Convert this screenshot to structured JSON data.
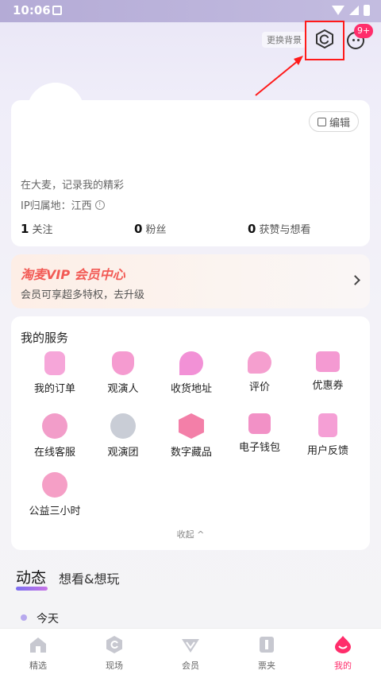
{
  "status_bar": {
    "time": "10:06"
  },
  "header": {
    "change_bg_label": "更换背景",
    "message_badge": "9+"
  },
  "profile": {
    "edit_label": "编辑",
    "bio": "在大麦，记录我的精彩",
    "ip_location": "IP归属地：江西",
    "stats": [
      {
        "value": "1",
        "label": "关注"
      },
      {
        "value": "0",
        "label": "粉丝"
      },
      {
        "value": "0",
        "label": "获赞与想看"
      }
    ]
  },
  "vip": {
    "title": "淘麦VIP 会员中心",
    "subtitle": "会员可享超多特权，去升级"
  },
  "services": {
    "title": "我的服务",
    "items": [
      {
        "label": "我的订单",
        "icon": "order-icon"
      },
      {
        "label": "观演人",
        "icon": "viewer-icon"
      },
      {
        "label": "收货地址",
        "icon": "address-icon"
      },
      {
        "label": "评价",
        "icon": "review-icon"
      },
      {
        "label": "优惠券",
        "icon": "coupon-icon"
      },
      {
        "label": "在线客服",
        "icon": "customer-service-icon"
      },
      {
        "label": "观演团",
        "icon": "group-icon"
      },
      {
        "label": "数字藏品",
        "icon": "digital-collection-icon"
      },
      {
        "label": "电子钱包",
        "icon": "wallet-icon"
      },
      {
        "label": "用户反馈",
        "icon": "feedback-icon"
      },
      {
        "label": "公益三小时",
        "icon": "charity-icon"
      }
    ],
    "collapse_label": "收起 ^"
  },
  "feed_tabs": {
    "active": "动态",
    "other": "想看&想玩"
  },
  "timeline": {
    "today": "今天"
  },
  "bottom_nav": [
    {
      "label": "精选",
      "icon": "home-icon"
    },
    {
      "label": "现场",
      "icon": "live-icon"
    },
    {
      "label": "会员",
      "icon": "member-icon"
    },
    {
      "label": "票夹",
      "icon": "ticket-icon"
    },
    {
      "label": "我的",
      "icon": "profile-icon"
    }
  ],
  "colors": {
    "accent": "#ff2d6b",
    "highlight": "#ff1a1a",
    "vip": "#f25a55"
  }
}
